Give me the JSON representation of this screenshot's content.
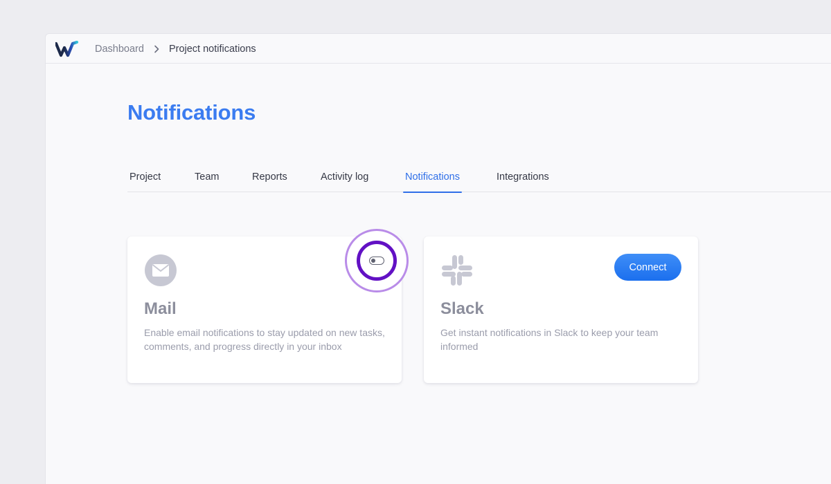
{
  "breadcrumb": {
    "parent": "Dashboard",
    "current": "Project notifications"
  },
  "page": {
    "title": "Notifications"
  },
  "tabs": [
    {
      "label": "Project"
    },
    {
      "label": "Team"
    },
    {
      "label": "Reports"
    },
    {
      "label": "Activity log"
    },
    {
      "label": "Notifications",
      "active": true
    },
    {
      "label": "Integrations"
    }
  ],
  "cards": {
    "mail": {
      "title": "Mail",
      "description": "Enable email notifications to stay updated on new tasks, comments, and progress directly in your inbox",
      "icon": "mail-icon",
      "toggle_on": false
    },
    "slack": {
      "title": "Slack",
      "description": "Get instant notifications in Slack to keep your team informed",
      "icon": "slack-icon",
      "button_label": "Connect"
    }
  },
  "colors": {
    "accent": "#3b7cf0",
    "highlight_ring": "#6211c4",
    "highlight_halo": "#b98ce8"
  }
}
